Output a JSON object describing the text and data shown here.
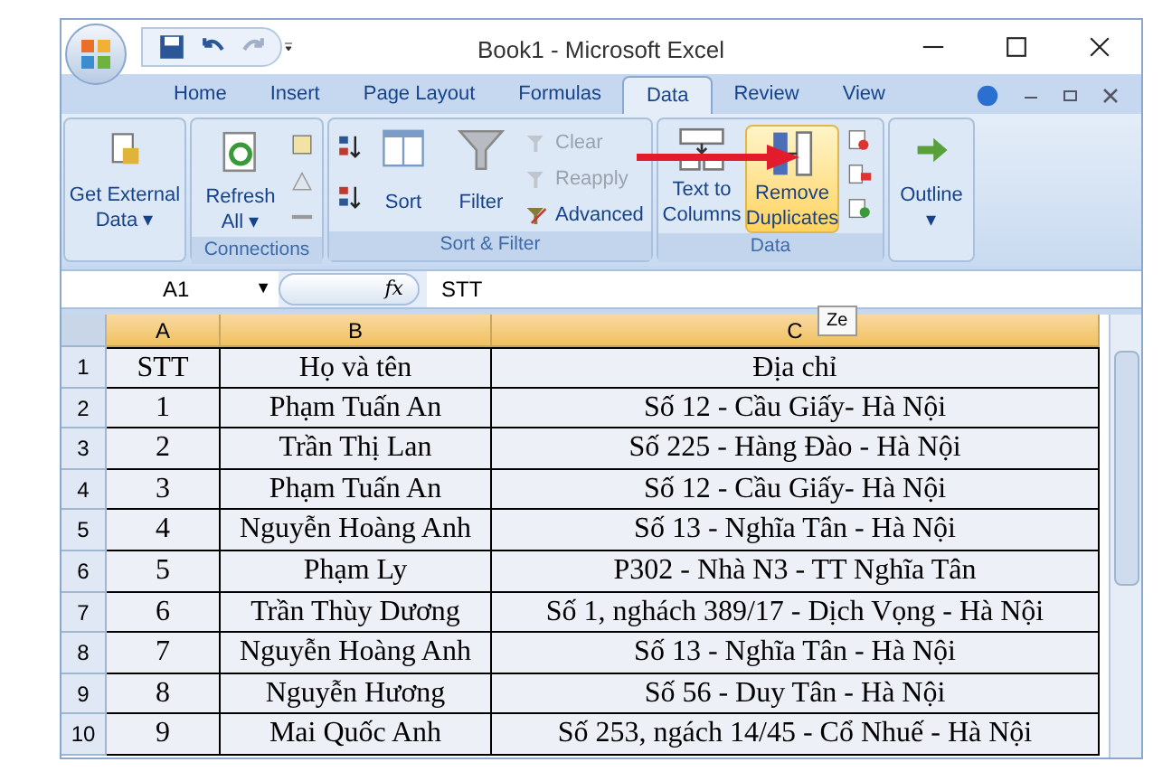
{
  "window": {
    "title": "Book1 - Microsoft Excel"
  },
  "tabs": [
    {
      "label": "Home",
      "selected": false
    },
    {
      "label": "Insert",
      "selected": false
    },
    {
      "label": "Page Layout",
      "selected": false
    },
    {
      "label": "Formulas",
      "selected": false
    },
    {
      "label": "Data",
      "selected": true
    },
    {
      "label": "Review",
      "selected": false
    },
    {
      "label": "View",
      "selected": false
    }
  ],
  "ribbon": {
    "get_external": "Get External Data",
    "get_external_caret": "▾",
    "connections": {
      "refresh": "Refresh All",
      "caret": "▾",
      "label": "Connections"
    },
    "sort_filter": {
      "sort": "Sort",
      "filter": "Filter",
      "clear": {
        "label": "Clear",
        "disabled": true
      },
      "reapply": {
        "label": "Reapply",
        "disabled": true
      },
      "advanced": {
        "label": "Advanced",
        "disabled": false
      },
      "label": "Sort & Filter"
    },
    "data_tools": {
      "text_to_columns": "Text to Columns",
      "remove_duplicates": {
        "label": "Remove Duplicates",
        "highlighted": true
      },
      "label": "Data"
    },
    "outline": {
      "label": "Outline",
      "caret": "▾"
    }
  },
  "tooltip": "Ze",
  "formula_bar": {
    "name_box": "A1",
    "name_box_caret": "▼",
    "fx": "fx",
    "value": "STT"
  },
  "columns": [
    "A",
    "B",
    "C"
  ],
  "rows": [
    {
      "header": "1",
      "cells": [
        "STT",
        "Họ và tên",
        "Địa chỉ"
      ]
    },
    {
      "header": "2",
      "cells": [
        "1",
        "Phạm Tuấn An",
        "Số 12 - Cầu Giấy- Hà Nội"
      ]
    },
    {
      "header": "3",
      "cells": [
        "2",
        "Trần Thị Lan",
        "Số 225 - Hàng Đào - Hà Nội"
      ]
    },
    {
      "header": "4",
      "cells": [
        "3",
        "Phạm Tuấn An",
        "Số 12 - Cầu Giấy- Hà Nội"
      ]
    },
    {
      "header": "5",
      "cells": [
        "4",
        "Nguyễn Hoàng Anh",
        "Số 13 - Nghĩa Tân - Hà Nội"
      ]
    },
    {
      "header": "6",
      "cells": [
        "5",
        "Phạm Ly",
        "P302 - Nhà N3 - TT Nghĩa Tân"
      ]
    },
    {
      "header": "7",
      "cells": [
        "6",
        "Trần Thùy Dương",
        "Số 1, nghách 389/17 - Dịch Vọng - Hà Nội"
      ]
    },
    {
      "header": "8",
      "cells": [
        "7",
        "Nguyễn Hoàng Anh",
        "Số 13 - Nghĩa Tân - Hà Nội"
      ]
    },
    {
      "header": "9",
      "cells": [
        "8",
        "Nguyễn Hương",
        "Số 56 - Duy Tân - Hà Nội"
      ]
    },
    {
      "header": "10",
      "cells": [
        "9",
        "Mai Quốc Anh",
        "Số 253, ngách 14/45 - Cổ Nhuế - Hà Nội"
      ]
    }
  ]
}
